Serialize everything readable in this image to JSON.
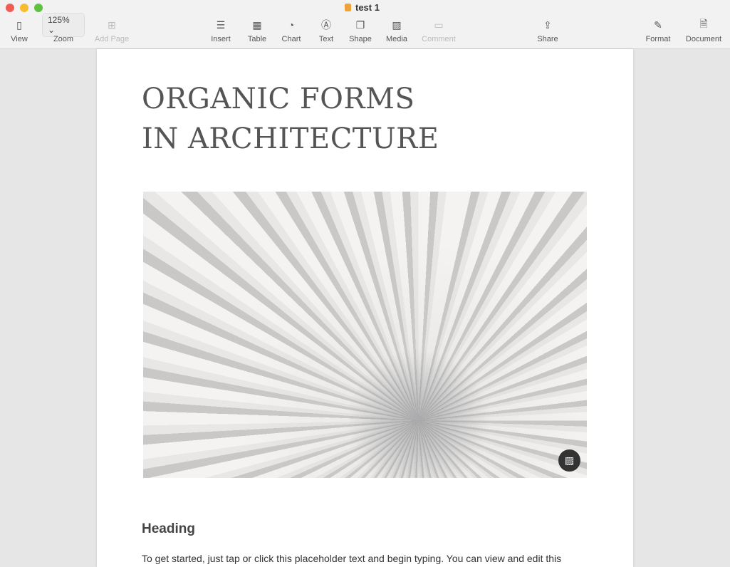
{
  "window": {
    "title": "test 1"
  },
  "toolbar": {
    "view": "View",
    "zoom_value": "125%",
    "zoom": "Zoom",
    "add_page": "Add Page",
    "insert": "Insert",
    "table": "Table",
    "chart": "Chart",
    "text": "Text",
    "shape": "Shape",
    "media": "Media",
    "comment": "Comment",
    "share": "Share",
    "format": "Format",
    "document": "Document"
  },
  "document": {
    "title_line1": "ORGANIC FORMS",
    "title_line2": "IN ARCHITECTURE",
    "heading": "Heading",
    "body": "To get started, just tap or click this placeholder text and begin typing. You can view and edit this"
  },
  "colors": {
    "close": "#ee5e57",
    "minimize": "#f5bd2f",
    "zoom": "#5fc13f"
  }
}
